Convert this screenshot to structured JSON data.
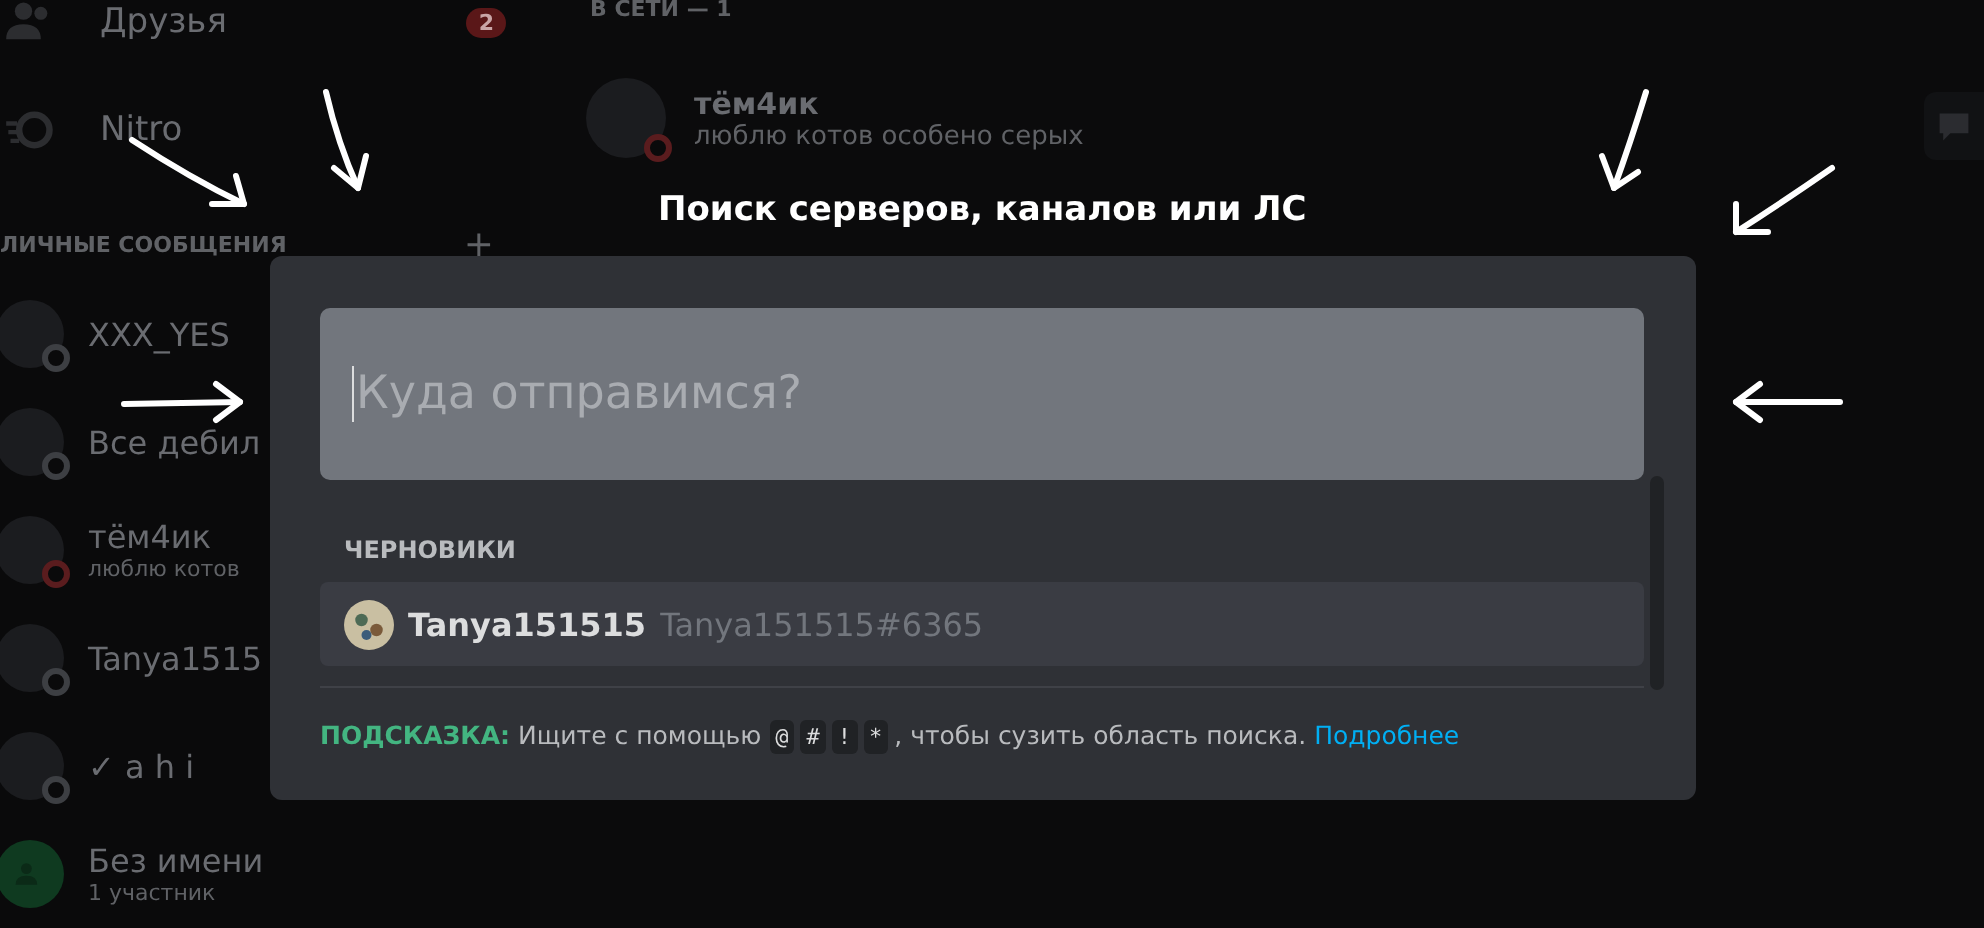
{
  "sidebar": {
    "nav": [
      {
        "label": "Друзья",
        "kind": "friends",
        "badge": "2"
      },
      {
        "label": "Nitro",
        "kind": "nitro"
      }
    ],
    "section_title": "ЛИЧНЫЕ СООБЩЕНИЯ",
    "section_action": "+",
    "dms": [
      {
        "name": "XXX_YES",
        "kind": "user",
        "color": "#3d3f43"
      },
      {
        "name": "Все дебил",
        "kind": "user",
        "color": "#3d3f43"
      },
      {
        "name": "тём4ик",
        "subtitle": "люблю котов",
        "kind": "user",
        "color": "#5a1c1e"
      },
      {
        "name": "Tanya1515",
        "kind": "user",
        "color": "#3d3f43"
      },
      {
        "name": "✓ a h i",
        "kind": "user",
        "color": "#3d3f43"
      },
      {
        "name": "Без имени",
        "subtitle": "1 участник",
        "kind": "group"
      }
    ]
  },
  "main": {
    "section_title": "В СЕТИ — 1",
    "friends": [
      {
        "name": "тём4ик",
        "status_text": "люблю котов особено серых",
        "color": "#5a1c1e"
      }
    ]
  },
  "dialog": {
    "title": "Поиск серверов, каналов или ЛС",
    "search": {
      "placeholder": "Куда отправимся?"
    },
    "section": "ЧЕРНОВИКИ",
    "results": [
      {
        "name": "Tanya151515",
        "tag": "Tanya151515#6365",
        "selected": true
      }
    ],
    "tip": {
      "label": "ПОДСКАЗКА:",
      "text_before": "Ищите с помощью",
      "keys": [
        "@",
        "#",
        "!",
        "*"
      ],
      "text_after": ", чтобы сузить область поиска.",
      "link": "Подробнее"
    }
  }
}
